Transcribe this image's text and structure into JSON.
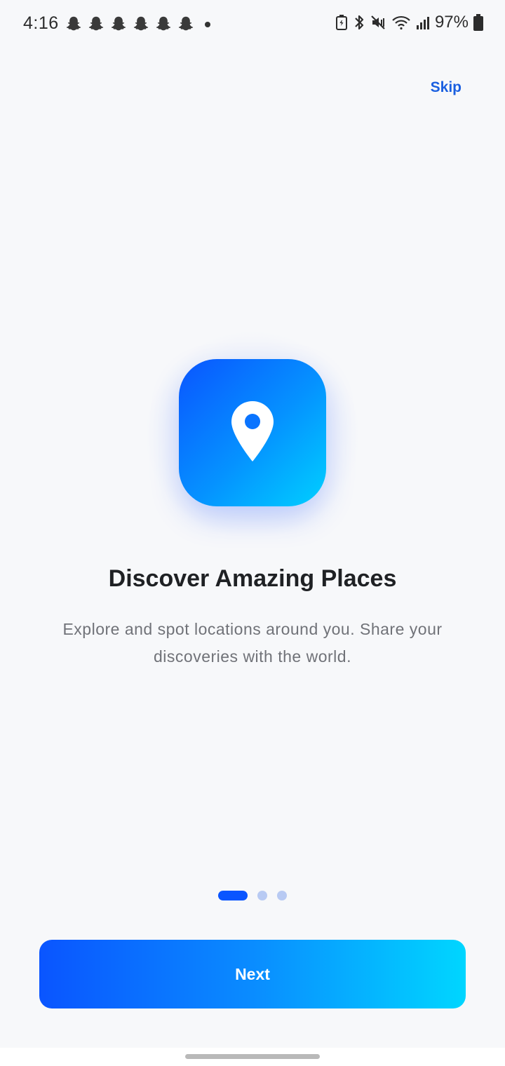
{
  "status_bar": {
    "time": "4:16",
    "notification_icons": [
      "snapchat-icon",
      "snapchat-icon",
      "snapchat-icon",
      "snapchat-icon",
      "snapchat-icon",
      "snapchat-icon"
    ],
    "battery_percent": "97%"
  },
  "onboarding": {
    "skip_label": "Skip",
    "title": "Discover Amazing Places",
    "description": "Explore and spot locations around you. Share your discoveries with the world.",
    "icon": "location-pin-icon",
    "page_indicator": {
      "total": 3,
      "current": 1
    },
    "next_label": "Next"
  },
  "colors": {
    "accent": "#0a55ff",
    "gradient_end": "#00d6ff",
    "background": "#f7f8fa",
    "skip_text": "#1a5fe0"
  }
}
